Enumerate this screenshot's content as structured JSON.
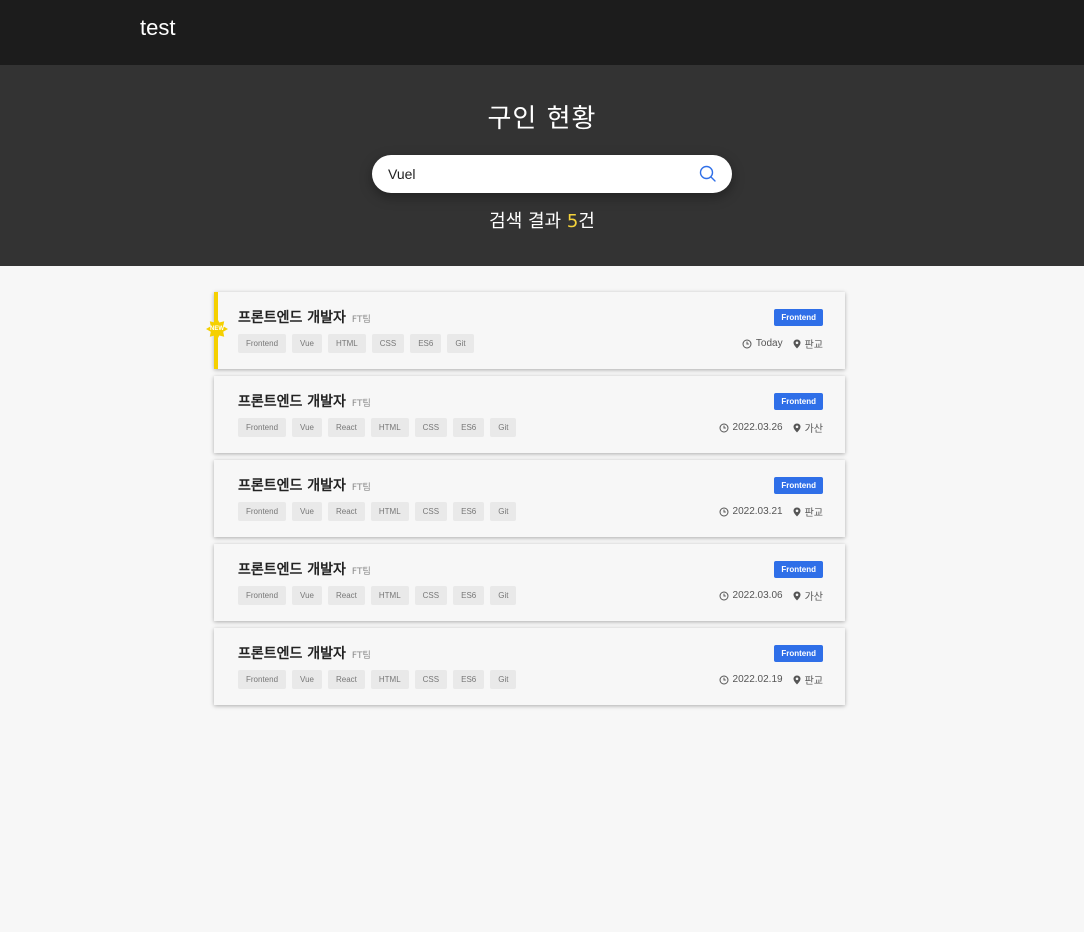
{
  "header": {
    "brand": "test"
  },
  "hero": {
    "title": "구인 현황",
    "search": {
      "value": "Vuel",
      "placeholder": ""
    },
    "result_prefix": "검색 결과 ",
    "result_count": "5",
    "result_suffix": "건"
  },
  "colors": {
    "accent_new": "#f5d000",
    "badge": "#2f6fe8",
    "count": "#f5d33b"
  },
  "jobs": [
    {
      "title": "프론트엔드 개발자",
      "team": "FT팀",
      "tags": [
        "Frontend",
        "Vue",
        "HTML",
        "CSS",
        "ES6",
        "Git"
      ],
      "badge": "Frontend",
      "date": "Today",
      "location": "판교",
      "new": true,
      "new_label": "NEW"
    },
    {
      "title": "프론트엔드 개발자",
      "team": "FT팀",
      "tags": [
        "Frontend",
        "Vue",
        "React",
        "HTML",
        "CSS",
        "ES6",
        "Git"
      ],
      "badge": "Frontend",
      "date": "2022.03.26",
      "location": "가산",
      "new": false
    },
    {
      "title": "프론트엔드 개발자",
      "team": "FT팀",
      "tags": [
        "Frontend",
        "Vue",
        "React",
        "HTML",
        "CSS",
        "ES6",
        "Git"
      ],
      "badge": "Frontend",
      "date": "2022.03.21",
      "location": "판교",
      "new": false
    },
    {
      "title": "프론트엔드 개발자",
      "team": "FT팀",
      "tags": [
        "Frontend",
        "Vue",
        "React",
        "HTML",
        "CSS",
        "ES6",
        "Git"
      ],
      "badge": "Frontend",
      "date": "2022.03.06",
      "location": "가산",
      "new": false
    },
    {
      "title": "프론트엔드 개발자",
      "team": "FT팀",
      "tags": [
        "Frontend",
        "Vue",
        "React",
        "HTML",
        "CSS",
        "ES6",
        "Git"
      ],
      "badge": "Frontend",
      "date": "2022.02.19",
      "location": "판교",
      "new": false
    }
  ]
}
